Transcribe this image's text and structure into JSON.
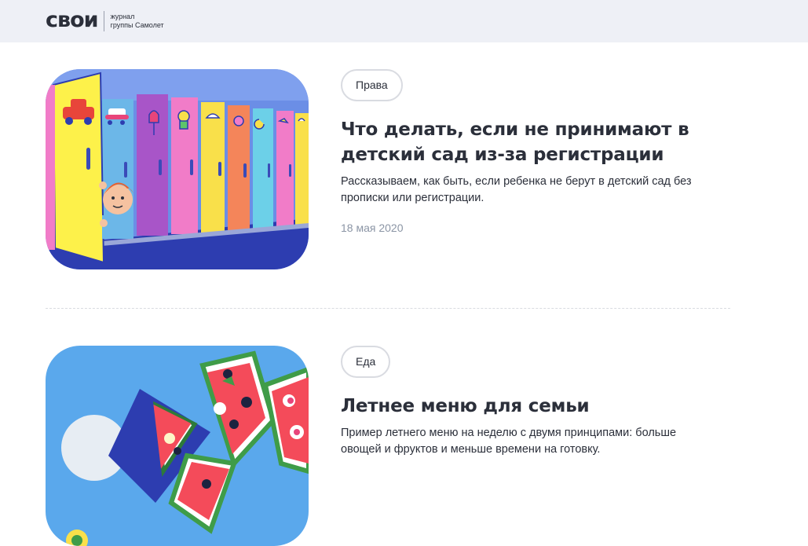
{
  "header": {
    "logo_word": "свои",
    "logo_tag_line1": "журнал",
    "logo_tag_line2": "группы Самолет"
  },
  "articles": [
    {
      "tag": "Права",
      "title": "Что делать, если не принимают в детский сад из-за регистрации",
      "description": "Рассказываем, как быть, если ребенка не берут в детский сад без прописки или регистрации.",
      "date": "18 мая 2020"
    },
    {
      "tag": "Еда",
      "title": "Летнее меню для семьи",
      "description": "Пример летнего меню на неделю с двумя принципами: больше овощей и фруктов и меньше времени на готовку."
    }
  ],
  "colors": {
    "header_bg": "#eef0f6",
    "text": "#2b2f3a",
    "muted": "#8b95a5",
    "tag_border": "#d9dbe1"
  }
}
